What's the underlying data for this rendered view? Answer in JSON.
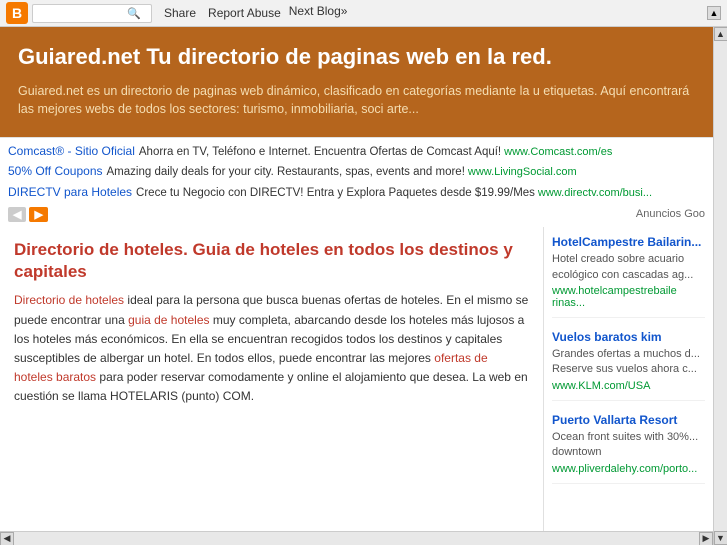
{
  "topbar": {
    "blogger_letter": "B",
    "search_placeholder": "",
    "share_label": "Share",
    "report_abuse_label": "Report Abuse",
    "next_blog_label": "Next Blog»"
  },
  "header": {
    "title": "Guiared.net Tu directorio de paginas web en la red.",
    "description": "Guiared.net es un directorio de paginas web dinámico, clasificado en categorías mediante la u etiquetas. Aquí encontrará las mejores webs de todos los sectores: turismo, inmobiliaria, soci arte..."
  },
  "ads": [
    {
      "link": "Comcast® - Sitio Oficial",
      "text": "Ahorra en TV, Teléfono e Internet. Encuentra Ofertas de Comcast Aquí!",
      "url": "www.Comcast.com/es"
    },
    {
      "link": "50% Off Coupons",
      "text": "Amazing daily deals for your city. Restaurants, spas, events and more!",
      "url": "www.LivingSocial.com"
    },
    {
      "link": "DIRECTV para Hoteles",
      "text": "Crece tu Negocio con DIRECTV! Entra y Explora Paquetes desde $19.99/Mes",
      "url": "www.directv.com/busi..."
    }
  ],
  "anuncios_label": "Anuncios Goo",
  "article": {
    "title": "Directorio de hoteles. Guia de hoteles en todos los destinos y capitales",
    "body_parts": [
      {
        "text": "Directorio de hoteles",
        "link": true
      },
      {
        "text": " ideal para la persona que busca buenas ofertas de hoteles. En el mismo se puede encontrar una ",
        "link": false
      },
      {
        "text": "guia de hoteles",
        "link": true
      },
      {
        "text": " muy completa, abarcando desde los hoteles más lujosos a los hoteles más económicos.  En ella se encuentran recogidos todos los destinos y capitales susceptibles de albergar un hotel. En todos ellos, puede encontrar las mejores ",
        "link": false
      },
      {
        "text": "ofertas de hoteles baratos",
        "link": true
      },
      {
        "text": " para poder reservar comodamente y online el alojamiento que desea. La web en cuestión se llama HOTELARIS (punto) COM.",
        "link": false
      }
    ]
  },
  "sidebar": {
    "items": [
      {
        "title": "HotelCampestre Bailarin...",
        "text": "Hotel creado sobre acuario ecológico con cascadas ag...",
        "url": "www.hotelcampestrebaile rinas..."
      },
      {
        "title": "Vuelos baratos kim",
        "text": "Grandes ofertas a muchos d... Reserve sus vuelos ahora c...",
        "url": "www.KLM.com/USA"
      },
      {
        "title": "Puerto Vallarta Resort",
        "text": "Ocean front suites with 30%... downtown",
        "url": "www.pliverdalehy.com/porto..."
      }
    ]
  }
}
